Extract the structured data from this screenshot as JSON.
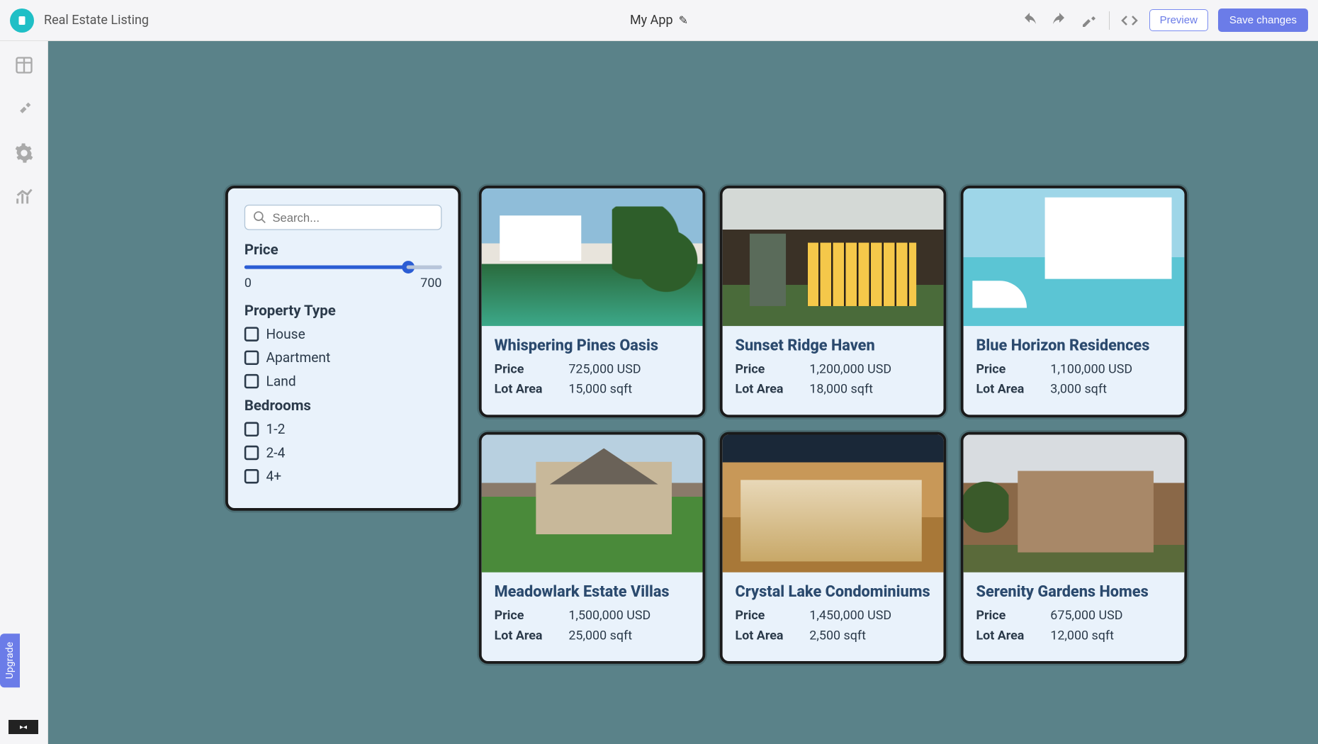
{
  "header": {
    "page_title": "Real Estate Listing",
    "app_name": "My App",
    "preview_label": "Preview",
    "save_label": "Save changes"
  },
  "left_rail": {
    "upgrade_label": "Upgrade"
  },
  "filters": {
    "search_placeholder": "Search...",
    "price_heading": "Price",
    "price_min": "0",
    "price_max": "700",
    "property_type_heading": "Property Type",
    "property_types": [
      "House",
      "Apartment",
      "Land"
    ],
    "bedrooms_heading": "Bedrooms",
    "bedroom_options": [
      "1-2",
      "2-4",
      "4+"
    ]
  },
  "listings": [
    {
      "title": "Whispering Pines Oasis",
      "price_label": "Price",
      "price": "725,000 USD",
      "lot_label": "Lot Area",
      "lot": "15,000 sqft",
      "img": "img1"
    },
    {
      "title": "Sunset Ridge Haven",
      "price_label": "Price",
      "price": "1,200,000 USD",
      "lot_label": "Lot Area",
      "lot": "18,000 sqft",
      "img": "img2"
    },
    {
      "title": "Blue Horizon Residences",
      "price_label": "Price",
      "price": "1,100,000 USD",
      "lot_label": "Lot Area",
      "lot": "3,000 sqft",
      "img": "img3"
    },
    {
      "title": "Meadowlark Estate Villas",
      "price_label": "Price",
      "price": "1,500,000 USD",
      "lot_label": "Lot Area",
      "lot": "25,000 sqft",
      "img": "img4"
    },
    {
      "title": "Crystal Lake Condominiums",
      "price_label": "Price",
      "price": "1,450,000 USD",
      "lot_label": "Lot Area",
      "lot": "2,500 sqft",
      "img": "img5"
    },
    {
      "title": "Serenity Gardens Homes",
      "price_label": "Price",
      "price": "675,000 USD",
      "lot_label": "Lot Area",
      "lot": "12,000 sqft",
      "img": "img6"
    }
  ]
}
